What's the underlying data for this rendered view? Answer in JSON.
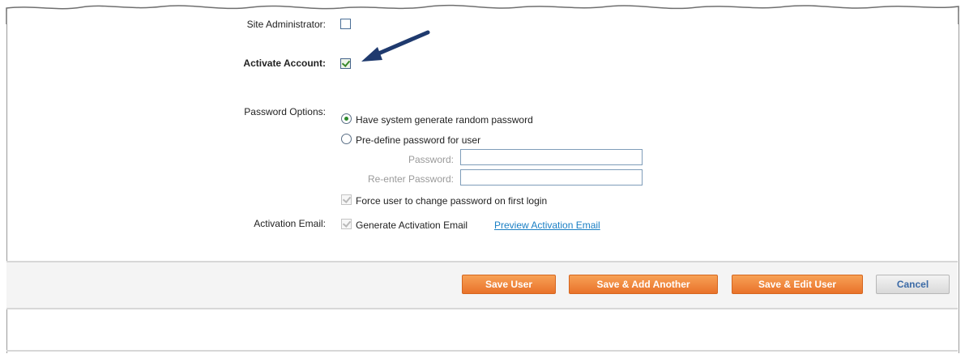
{
  "form": {
    "site_admin_label": "Site Administrator:",
    "activate_label": "Activate Account:",
    "password_options_label": "Password Options:",
    "radio_random_label": "Have system generate random password",
    "radio_predefine_label": "Pre-define password for user",
    "password_label": "Password:",
    "password_value": "",
    "reenter_label": "Re-enter Password:",
    "reenter_value": "",
    "force_change_label": "Force user to change password on first login",
    "activation_email_label": "Activation Email:",
    "generate_email_label": "Generate Activation Email",
    "preview_link": "Preview Activation Email"
  },
  "state": {
    "site_admin_checked": false,
    "activate_checked": true,
    "random_password_selected": true,
    "force_change_checked": true,
    "generate_email_checked": true
  },
  "buttons": {
    "save_user": "Save User",
    "save_add_another": "Save & Add Another",
    "save_edit_user": "Save & Edit User",
    "cancel": "Cancel"
  },
  "colors": {
    "orange_button": "#e9722a",
    "link": "#1a7fc4",
    "arrow": "#1f3a6e",
    "check": "#3a8a2a"
  },
  "icons": {
    "annotation": "arrow-pointer-icon"
  }
}
